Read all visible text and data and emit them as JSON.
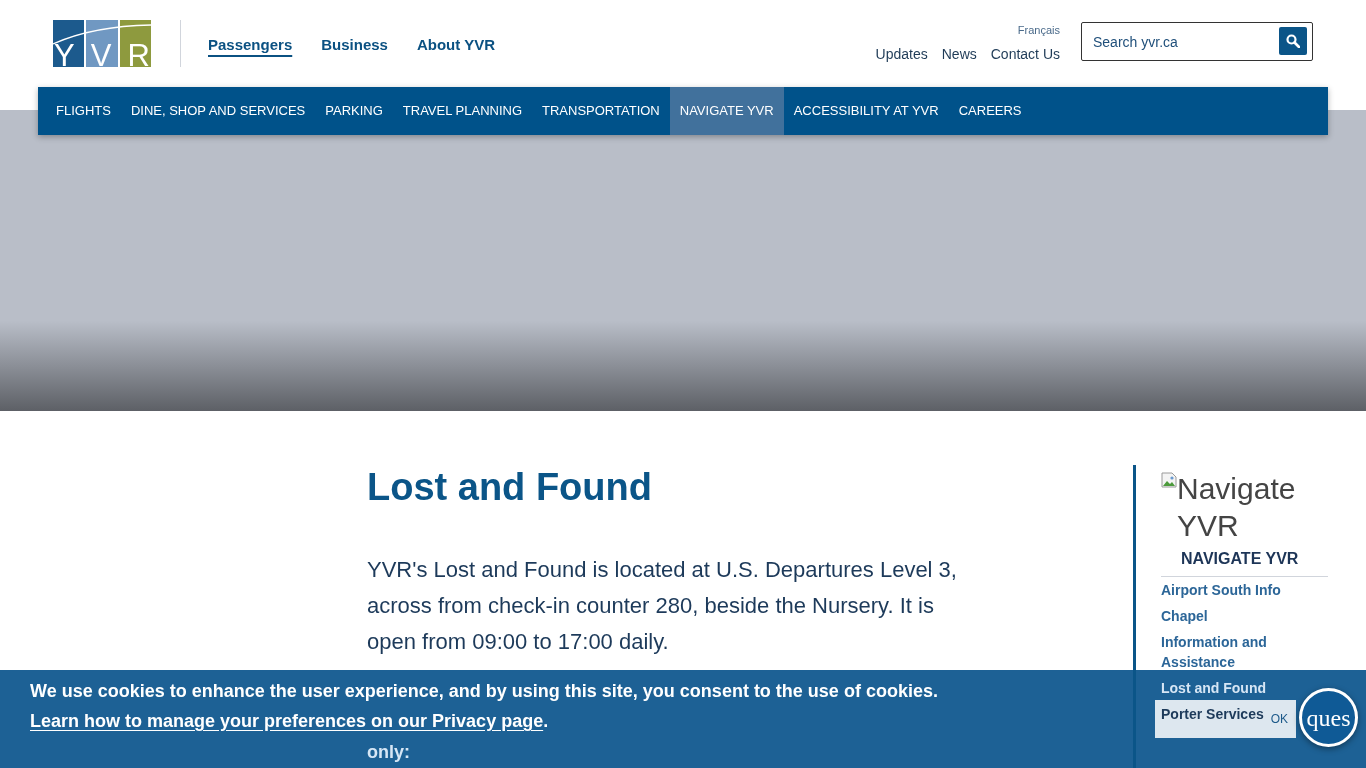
{
  "logo": {
    "text": "YVR"
  },
  "audience_tabs": [
    {
      "label": "Passengers",
      "selected": true
    },
    {
      "label": "Business",
      "selected": false
    },
    {
      "label": "About YVR",
      "selected": false
    }
  ],
  "language_link": "Français",
  "utility_links": [
    "Updates",
    "News",
    "Contact Us"
  ],
  "search": {
    "placeholder": "Search yvr.ca"
  },
  "main_nav": [
    {
      "label": "FLIGHTS",
      "selected": false
    },
    {
      "label": "DINE, SHOP AND SERVICES",
      "selected": false
    },
    {
      "label": "PARKING",
      "selected": false
    },
    {
      "label": "TRAVEL PLANNING",
      "selected": false
    },
    {
      "label": "TRANSPORTATION",
      "selected": false
    },
    {
      "label": "NAVIGATE YVR",
      "selected": true
    },
    {
      "label": "ACCESSIBILITY AT YVR",
      "selected": false
    },
    {
      "label": "CAREERS",
      "selected": false
    }
  ],
  "page": {
    "title": "Lost and Found",
    "paragraph": "YVR's Lost and Found is located at U.S. Departures Level 3, across from check-in counter 280, beside the Nursery. It is open from 09:00 to 17:00 daily.",
    "paragraph_2": "only:"
  },
  "sidebar": {
    "image_alt": "Navigate YVR",
    "heading": "NAVIGATE YVR",
    "links": [
      "Airport South Info",
      "Chapel",
      "Information and Assistance",
      "Lost and Found",
      "Porter Services"
    ]
  },
  "cookie_banner": {
    "message": "We use cookies to enhance the user experience, and by using this site, you consent to the use of cookies.",
    "link": "Learn how to manage your preferences on our Privacy page",
    "message_end": ".",
    "button": "OK"
  },
  "chat_widget": {
    "label": "ques"
  }
}
